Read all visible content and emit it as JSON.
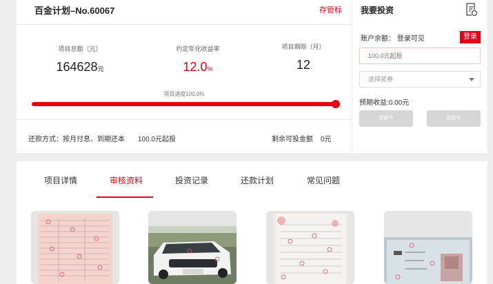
{
  "project": {
    "title": "百金计划–No.60067",
    "deposit_link": "存管标",
    "stats": [
      {
        "label": "项目总额（元）",
        "value": "164628",
        "unit": "元"
      },
      {
        "label": "约定年化收益率",
        "value": "12.0",
        "unit": "%"
      },
      {
        "label": "项目期限（月）",
        "value": "12",
        "unit": ""
      }
    ],
    "progress_label": "项目进度100.0%",
    "progress_percent": 100,
    "repayment": "还款方式：按月付息、到期还本",
    "min_invest": "100.0元起投",
    "remaining_label": "剩余可投金额",
    "remaining_value": "0元"
  },
  "invest": {
    "title": "我要投资",
    "balance": "账户余额：  登录可见",
    "login_button": "登录",
    "amount_placeholder": "100.0元起投",
    "coupon_placeholder": "选择奖券",
    "expected": "预期收益:0.00元",
    "button_left": "还款中",
    "button_right": "还款中"
  },
  "tabs": [
    "项目详情",
    "审核资料",
    "投资记录",
    "还款计划",
    "常见问题"
  ],
  "active_tab": 1,
  "colors": {
    "accent": "#e60012",
    "muted_button": "#d6d6d6"
  }
}
